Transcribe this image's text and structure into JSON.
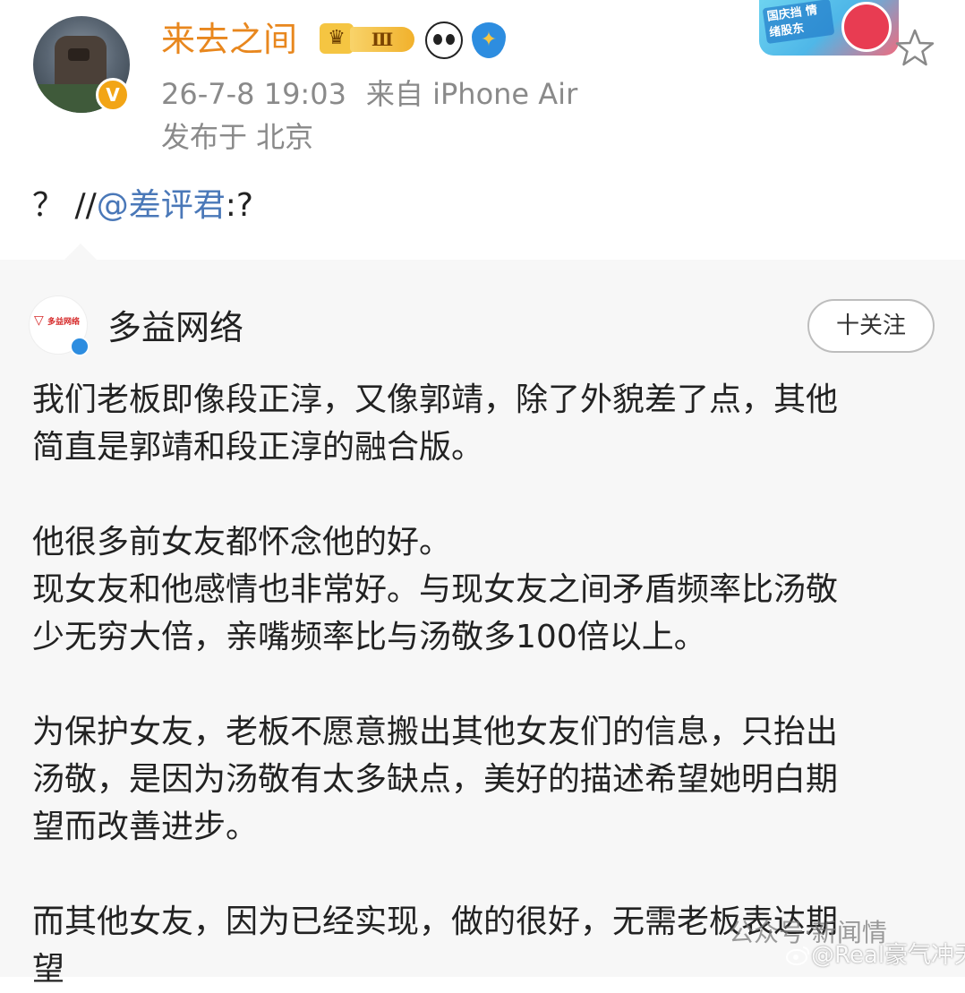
{
  "header": {
    "username": "来去之间",
    "vip_level": "Ⅲ",
    "icons": [
      "crown-icon",
      "panda-icon",
      "shield-icon",
      "festival-badge",
      "star-icon"
    ],
    "timestamp": "26-7-8 19:03",
    "source": "来自 iPhone Air",
    "location": "发布于 北京",
    "festival_badge_text": "国庆挡 情绪股东"
  },
  "comment": {
    "prefix": "？ //",
    "mention": "@差评君",
    "suffix": ":?"
  },
  "original_post": {
    "author": "多益网络",
    "org_logo_text": "多益网络",
    "follow_label": "十关注",
    "paragraphs": [
      [
        "我们老板即像段正淳，又像郭靖，除了外貌差了点，其他",
        "简直是郭靖和段正淳的融合版。"
      ],
      [
        "他很多前女友都怀念他的好。",
        "现女友和他感情也非常好。与现女友之间矛盾频率比汤敬",
        "少无穷大倍，亲嘴频率比与汤敬多100倍以上。"
      ],
      [
        "为保护女友，老板不愿意搬出其他女友们的信息，只抬出",
        "汤敬，是因为汤敬有太多缺点，美好的描述希望她明白期",
        "望而改善进步。"
      ],
      [
        "而其他女友，因为已经实现，做的很好，无需老板表达期",
        "望"
      ]
    ]
  },
  "watermarks": {
    "top": "公众号·新闻情",
    "user": "@Real豪气冲天"
  },
  "colors": {
    "username": "#e8871e",
    "mention": "#4a78b8",
    "meta": "#8a8a8a",
    "card_bg": "#f7f7f7"
  }
}
